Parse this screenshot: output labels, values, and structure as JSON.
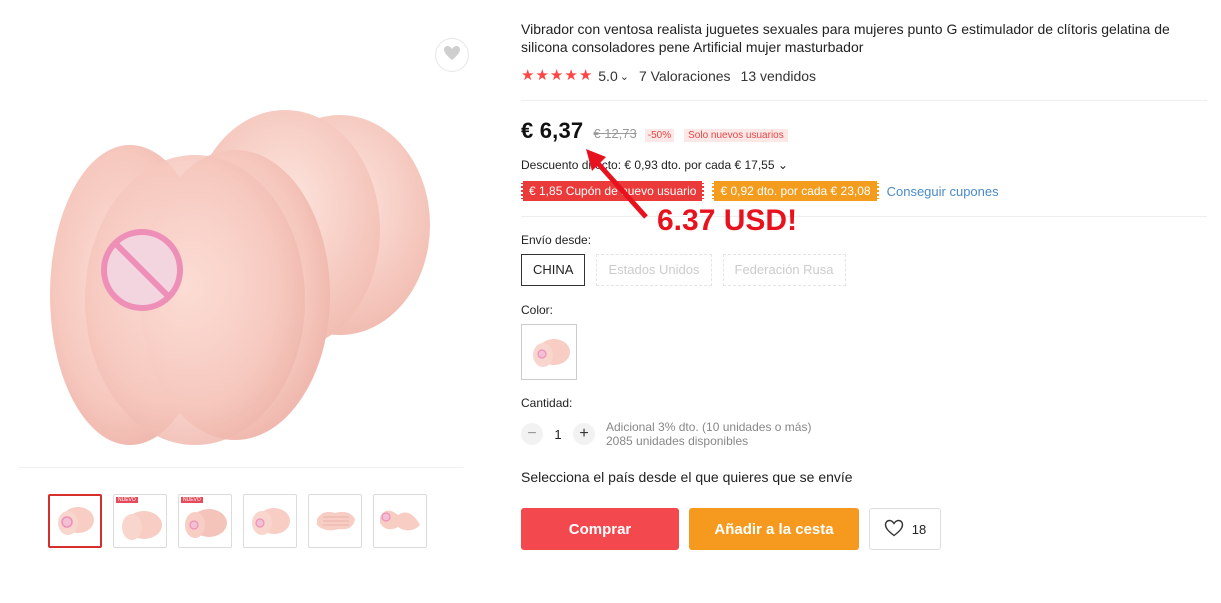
{
  "product": {
    "title": "Vibrador con ventosa realista juguetes sexuales para mujeres punto G estimulador de clítoris gelatina de silicona consoladores pene Artificial mujer masturbador",
    "rating_value": "5.0",
    "rating_caret": "⌄",
    "reviews": "7 Valoraciones",
    "sold": "13 vendidos",
    "stars": 5
  },
  "price": {
    "current": "€ 6,37",
    "original": "€ 12,73",
    "discount_badge": "-50%",
    "new_users_badge": "Solo nuevos usuarios"
  },
  "discount": {
    "text": "Descuento directo: € 0,93 dto. por cada € 17,55 ⌄"
  },
  "coupons": {
    "red": "€ 1,85 Cupón de nuevo usuario",
    "orange": "€ 0,92 dto. por cada € 23,08",
    "get_link": "Conseguir cupones"
  },
  "shipping": {
    "label": "Envío desde:",
    "options": [
      "CHINA",
      "Estados Unidos",
      "Federación Rusa"
    ],
    "selected": "CHINA"
  },
  "color": {
    "label": "Color:"
  },
  "quantity": {
    "label": "Cantidad:",
    "minus": "−",
    "value": "1",
    "plus": "+",
    "extra_discount": "Adicional 3% dto. (10 unidades o más)",
    "available": "2085 unidades disponibles"
  },
  "ship_note": "Selecciona el país desde el que quieres que se envíe",
  "actions": {
    "buy": "Comprar",
    "add_to_cart": "Añadir a la cesta",
    "wishlist_count": "18"
  },
  "annotation": {
    "text": "6.37 USD!",
    "color": "#e8121f"
  },
  "gallery": {
    "thumb_badge": "NUEVO"
  },
  "colors": {
    "accent_red": "#f4484f",
    "accent_orange": "#f59a1e",
    "product_pink": "#f7c9c0"
  }
}
